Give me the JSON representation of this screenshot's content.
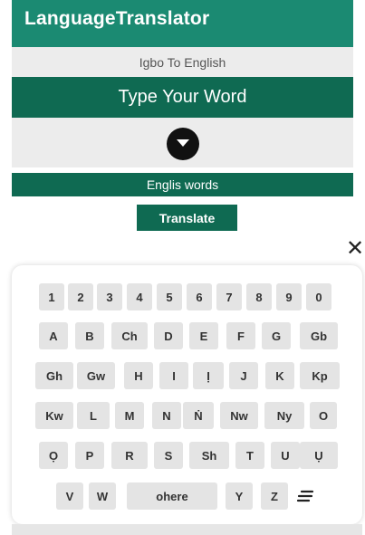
{
  "app": {
    "title": "LanguageTranslator"
  },
  "mode_label": "Igbo To English",
  "input": {
    "placeholder": "Type Your Word"
  },
  "output": {
    "text": "Englis words"
  },
  "translate_button": "Translate",
  "close_glyph": "✕",
  "keyboard": {
    "rows": [
      [
        "1",
        "2",
        "3",
        "4",
        "5",
        "6",
        "7",
        "8",
        "9",
        "0"
      ],
      [
        "A",
        "B",
        "Ch",
        "D",
        "E",
        "F",
        "G",
        "Gb"
      ],
      [
        "Gh",
        "Gw",
        "H",
        "I",
        "Ị",
        "J",
        "K",
        "Kp"
      ],
      [
        "Kw",
        "L",
        "M",
        "N",
        "Ṅ",
        "Nw",
        "Ny",
        "O"
      ],
      [
        "Ọ",
        "P",
        "R",
        "S",
        "Sh",
        "T",
        "U",
        "Ụ"
      ],
      [
        "V",
        "W",
        "ohere",
        "Y",
        "Z"
      ]
    ],
    "menu_icon": "menu-lines-icon"
  },
  "colors": {
    "appbar": "#1b8a72",
    "dark_green": "#0f6a52",
    "row_bg": "#ececec",
    "key_bg": "#e4e4e4"
  }
}
